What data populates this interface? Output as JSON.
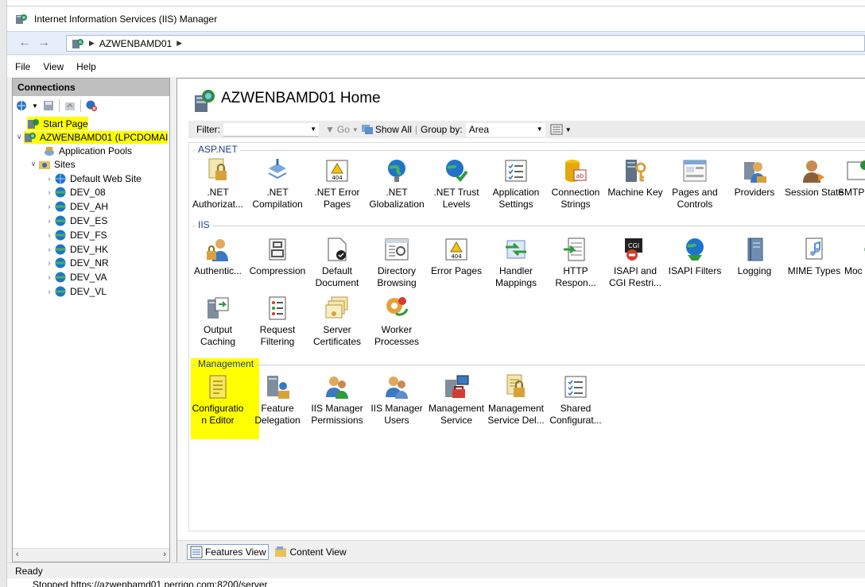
{
  "window": {
    "title": "Internet Information Services (IIS) Manager"
  },
  "nav": {
    "address_segment": "AZWENBAMD01"
  },
  "menu": [
    "File",
    "View",
    "Help"
  ],
  "connections": {
    "header": "Connections",
    "tree": [
      {
        "label": "Start Page"
      },
      {
        "label": "AZWENBAMD01 (LPCDOMAI"
      },
      {
        "label": "Application Pools"
      },
      {
        "label": "Sites"
      },
      {
        "label": "Default Web Site"
      },
      {
        "label": "DEV_08"
      },
      {
        "label": "DEV_AH"
      },
      {
        "label": "DEV_ES"
      },
      {
        "label": "DEV_FS"
      },
      {
        "label": "DEV_HK"
      },
      {
        "label": "DEV_NR"
      },
      {
        "label": "DEV_VA"
      },
      {
        "label": "DEV_VL"
      }
    ]
  },
  "main": {
    "title": "AZWENBAMD01 Home",
    "filter": {
      "label": "Filter:",
      "go": "Go",
      "show_all": "Show All",
      "group_by": "Group by:",
      "group_value": "Area"
    },
    "sections": {
      "aspnet": {
        "label": "ASP.NET",
        "items": [
          {
            "l1": ".NET",
            "l2": "Authorizat..."
          },
          {
            "l1": ".NET",
            "l2": "Compilation"
          },
          {
            "l1": ".NET Error",
            "l2": "Pages"
          },
          {
            "l1": ".NET",
            "l2": "Globalization"
          },
          {
            "l1": ".NET Trust",
            "l2": "Levels"
          },
          {
            "l1": "Application",
            "l2": "Settings"
          },
          {
            "l1": "Connection",
            "l2": "Strings"
          },
          {
            "l1": "Machine Key",
            "l2": ""
          },
          {
            "l1": "Pages and",
            "l2": "Controls"
          },
          {
            "l1": "Providers",
            "l2": ""
          },
          {
            "l1": "Session State",
            "l2": ""
          },
          {
            "l1": "SMTP",
            "l2": ""
          }
        ]
      },
      "iis": {
        "label": "IIS",
        "items": [
          {
            "l1": "Authentic...",
            "l2": ""
          },
          {
            "l1": "Compression",
            "l2": ""
          },
          {
            "l1": "Default",
            "l2": "Document"
          },
          {
            "l1": "Directory",
            "l2": "Browsing"
          },
          {
            "l1": "Error Pages",
            "l2": ""
          },
          {
            "l1": "Handler",
            "l2": "Mappings"
          },
          {
            "l1": "HTTP",
            "l2": "Respon..."
          },
          {
            "l1": "ISAPI and",
            "l2": "CGI Restri..."
          },
          {
            "l1": "ISAPI Filters",
            "l2": ""
          },
          {
            "l1": "Logging",
            "l2": ""
          },
          {
            "l1": "MIME Types",
            "l2": ""
          },
          {
            "l1": "Moc",
            "l2": ""
          },
          {
            "l1": "Output",
            "l2": "Caching"
          },
          {
            "l1": "Request",
            "l2": "Filtering"
          },
          {
            "l1": "Server",
            "l2": "Certificates"
          },
          {
            "l1": "Worker",
            "l2": "Processes"
          }
        ]
      },
      "management": {
        "label": "Management",
        "items": [
          {
            "l1": "Configuratio",
            "l2": "n Editor"
          },
          {
            "l1": "Feature",
            "l2": "Delegation"
          },
          {
            "l1": "IIS Manager",
            "l2": "Permissions"
          },
          {
            "l1": "IIS Manager",
            "l2": "Users"
          },
          {
            "l1": "Management",
            "l2": "Service"
          },
          {
            "l1": "Management",
            "l2": "Service Del..."
          },
          {
            "l1": "Shared",
            "l2": "Configurat..."
          }
        ]
      }
    },
    "views": {
      "features": "Features View",
      "content": "Content View"
    }
  },
  "status": {
    "text": "Ready"
  },
  "bottom": {
    "text": "Stopped https://azwenbamd01.perrigo.com:8200/server"
  },
  "colors": {
    "highlight": "#ffff00",
    "section_label": "#1e3c87",
    "nav_bar": "#e6eff9"
  }
}
